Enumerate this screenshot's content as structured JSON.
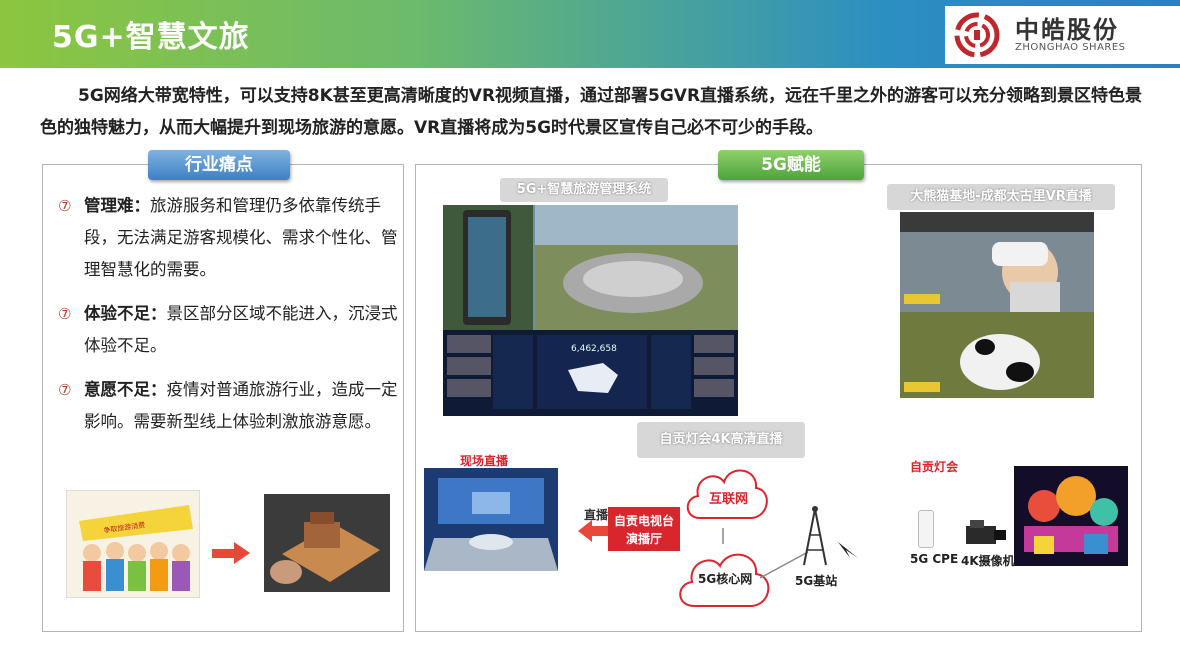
{
  "header": {
    "title": "5G+智慧文旅",
    "logo_cn": "中皓股份",
    "logo_en": "ZHONGHAO SHARES"
  },
  "intro": "5G网络大带宽特性，可以支持8K甚至更高清晰度的VR视频直播，通过部署5GVR直播系统，远在千里之外的游客可以充分领略到景区特色景色的独特魅力，从而大幅提升到现场旅游的意愿。VR直播将成为5G时代景区宣传自己必不可少的手段。",
  "left": {
    "tab": "行业痛点",
    "bullet": "⑦",
    "items": [
      {
        "title": "管理难：",
        "text": "旅游服务和管理仍多依靠传统手段，无法满足游客规模化、需求个性化、管理智慧化的需要。"
      },
      {
        "title": "体验不足：",
        "text": "景区部分区域不能进入，沉浸式体验不足。"
      },
      {
        "title": "意愿不足：",
        "text": "疫情对普通旅游行业，造成一定影响。需要新型线上体验刺激旅游意愿。"
      }
    ],
    "cartoon_banner": "争取旅游消费"
  },
  "right": {
    "tab": "5G赋能",
    "mgmt_label": "5G+智慧旅游管理系统",
    "panda_label": "大熊猫基地-成都太古里VR直播",
    "lantern_label": "自贡灯会4K高清直播",
    "dashboard_number": "6,462,658",
    "live_site": "现场直播",
    "studio": "自贡电视台\n演播厅",
    "direct": "直播",
    "internet": "互联网",
    "core": "5G核心网",
    "base": "5G基站",
    "lantern_event": "自贡灯会",
    "cpe": "5G CPE",
    "camera": "4K摄像机"
  },
  "colors": {
    "accent_red": "#d9262c",
    "tab_blue": "#3d7fc4",
    "tab_green": "#4ea33b"
  }
}
